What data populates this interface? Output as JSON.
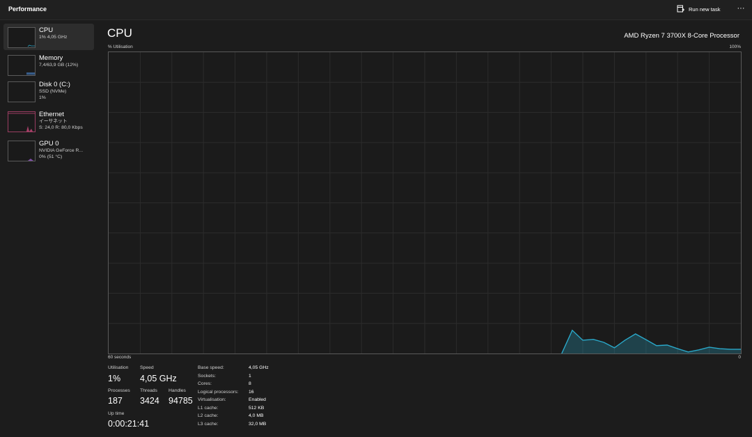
{
  "header": {
    "title": "Performance",
    "run_new_task_label": "Run new task",
    "more_glyph": "···"
  },
  "sidebar": {
    "items": [
      {
        "name": "CPU",
        "sub1": "1% 4,05 GHz",
        "sub2": "",
        "sub3": "",
        "color": "#2aa8c9",
        "active": true
      },
      {
        "name": "Memory",
        "sub1": "7,4/63,9 GB (12%)",
        "sub2": "",
        "sub3": "",
        "color": "#4a8ad8",
        "active": false
      },
      {
        "name": "Disk 0 (C:)",
        "sub1": "SSD (NVMe)",
        "sub2": "1%",
        "sub3": "",
        "color": "#4fb04f",
        "active": false
      },
      {
        "name": "Ethernet",
        "sub1": "イーサネット",
        "sub2": "S: 24,0  R: 80,0 Kbps",
        "sub3": "",
        "color": "#c9487a",
        "active": false
      },
      {
        "name": "GPU 0",
        "sub1": "NVIDIA GeForce R...",
        "sub2": "0% (51 °C)",
        "sub3": "",
        "color": "#9a5ad0",
        "active": false
      }
    ]
  },
  "main": {
    "title": "CPU",
    "processor": "AMD Ryzen 7 3700X 8-Core Processor",
    "y_label": "% Utilisation",
    "y_max_label": "100%",
    "x_left_label": "60 seconds",
    "x_right_label": "0"
  },
  "chart_data": {
    "type": "area",
    "x": [
      0,
      1,
      2,
      3,
      4,
      5,
      6,
      7,
      8,
      9,
      10,
      11,
      12,
      13,
      14,
      15,
      16,
      17,
      18,
      19,
      20,
      21,
      22,
      23,
      24,
      25,
      26,
      27,
      28,
      29,
      30,
      31,
      32,
      33,
      34,
      35,
      36,
      37,
      38,
      39,
      40,
      41,
      42,
      43,
      44,
      45,
      46,
      47,
      48,
      49,
      50,
      51,
      52,
      53,
      54,
      55,
      56,
      57,
      58,
      59,
      60
    ],
    "values": [
      0,
      0,
      0,
      0,
      0,
      0,
      0,
      0,
      0,
      0,
      0,
      0,
      0,
      0,
      0,
      0,
      0,
      0,
      0,
      0,
      0,
      0,
      0,
      0,
      0,
      0,
      0,
      0,
      0,
      0,
      0,
      0,
      0,
      0,
      0,
      0,
      0,
      0,
      0,
      0,
      0,
      0,
      0,
      0,
      7.7,
      4.4,
      4.7,
      3.7,
      1.9,
      4.4,
      6.5,
      4.6,
      2.6,
      2.8,
      1.6,
      0.5,
      1.2,
      2.1,
      1.6,
      1.4,
      1.4
    ],
    "xlabel": "60 seconds",
    "ylabel": "% Utilisation",
    "xlim": [
      0,
      60
    ],
    "ylim": [
      0,
      100
    ],
    "grid": true,
    "color": "#2aa8c9"
  },
  "stats": {
    "utilisation_label": "Utilisation",
    "utilisation": "1%",
    "speed_label": "Speed",
    "speed": "4,05 GHz",
    "processes_label": "Processes",
    "processes": "187",
    "threads_label": "Threads",
    "threads": "3424",
    "handles_label": "Handles",
    "handles": "94785",
    "uptime_label": "Up time",
    "uptime": "0:00:21:41"
  },
  "specs": [
    {
      "key": "Base speed:",
      "value": "4,05 GHz"
    },
    {
      "key": "Sockets:",
      "value": "1"
    },
    {
      "key": "Cores:",
      "value": "8"
    },
    {
      "key": "Logical processors:",
      "value": "16"
    },
    {
      "key": "Virtualisation:",
      "value": "Enabled"
    },
    {
      "key": "L1 cache:",
      "value": "512 KB"
    },
    {
      "key": "L2 cache:",
      "value": "4,0 MB"
    },
    {
      "key": "L3 cache:",
      "value": "32,0 MB"
    }
  ]
}
